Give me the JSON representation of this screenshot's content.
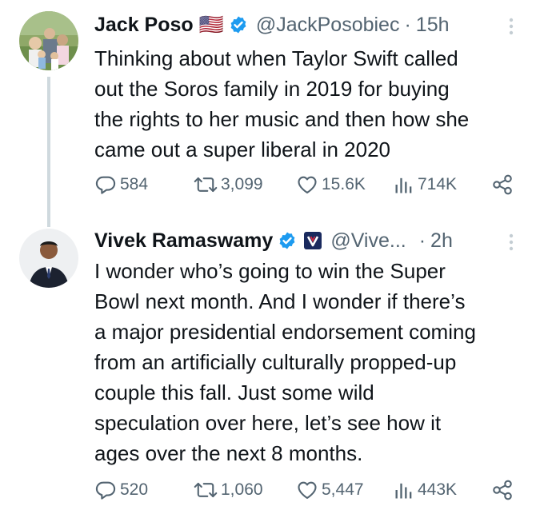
{
  "colors": {
    "text": "#0f1419",
    "muted": "#536471",
    "verified": "#1d9bf0",
    "thread": "#cfd9de"
  },
  "tweets": [
    {
      "name": "Jack Poso",
      "flag": "🇺🇸",
      "handle": "@JackPosobiec",
      "time": "15h",
      "text_lines": [
        "Thinking about when Taylor Swift called",
        "out the Soros family in 2019 for buying",
        "the rights to her music and then how she",
        "came out a super liberal in 2020"
      ],
      "stats": {
        "replies": "584",
        "retweets": "3,099",
        "likes": "15.6K",
        "views": "714K"
      }
    },
    {
      "name": "Vivek Ramaswamy",
      "handle": "@Vive...",
      "time": "2h",
      "text_lines": [
        "I wonder who’s going to win the Super",
        "Bowl next month. And I wonder if there’s",
        "a major presidential endorsement coming",
        "from an artificially culturally propped-up",
        "couple this fall. Just some wild",
        "speculation over here, let’s see how it",
        "ages over the next 8 months."
      ],
      "stats": {
        "replies": "520",
        "retweets": "1,060",
        "likes": "5,447",
        "views": "443K"
      }
    }
  ],
  "icons": [
    "reply-icon",
    "retweet-icon",
    "like-icon",
    "views-icon",
    "share-icon",
    "verified-icon",
    "more-icon"
  ]
}
